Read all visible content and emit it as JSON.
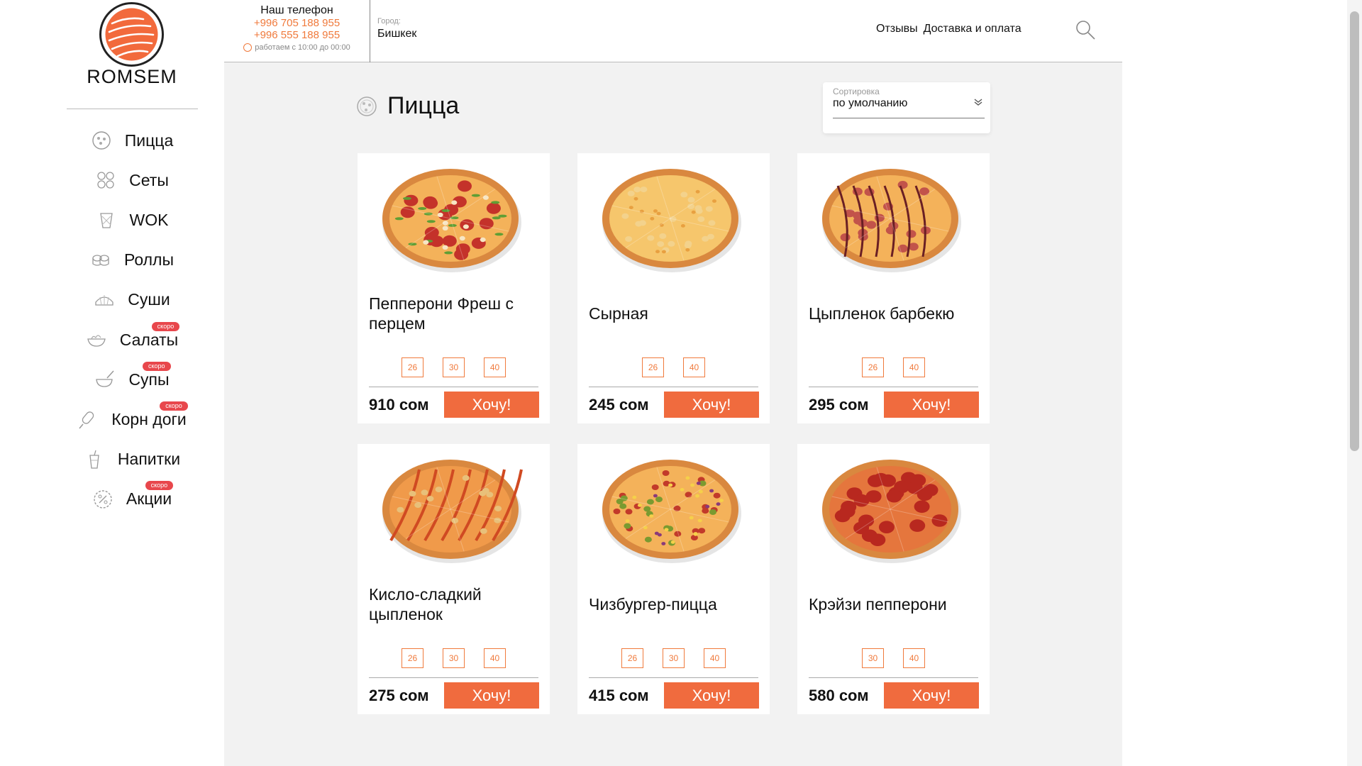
{
  "brand": {
    "name": "ROMSEM"
  },
  "sidebar": {
    "items": [
      {
        "label": "Пицца",
        "icon": "pizza-icon",
        "badge": ""
      },
      {
        "label": "Сеты",
        "icon": "sets-icon",
        "badge": ""
      },
      {
        "label": "WOK",
        "icon": "wok-icon",
        "badge": ""
      },
      {
        "label": "Роллы",
        "icon": "rolls-icon",
        "badge": ""
      },
      {
        "label": "Суши",
        "icon": "sushi-icon",
        "badge": ""
      },
      {
        "label": "Салаты",
        "icon": "salad-icon",
        "badge": "скоро"
      },
      {
        "label": "Супы",
        "icon": "soup-icon",
        "badge": "скоро"
      },
      {
        "label": "Корн доги",
        "icon": "corndog-icon",
        "badge": "скоро"
      },
      {
        "label": "Напитки",
        "icon": "drink-icon",
        "badge": ""
      },
      {
        "label": "Акции",
        "icon": "discount-icon",
        "badge": "скоро"
      }
    ]
  },
  "header": {
    "phone_title": "Наш телефон",
    "phones": [
      "+996 705 188 955",
      "+996 555 188 955"
    ],
    "hours": "работаем с 10:00 до 00:00",
    "city_label": "Город:",
    "city": "Бишкек",
    "links": [
      "Отзывы",
      "Доставка и оплата"
    ]
  },
  "page": {
    "title": "Пицца"
  },
  "sort": {
    "label": "Сортировка",
    "value": "по умолчанию"
  },
  "products": [
    {
      "name": "Пепперони Фреш с перцем",
      "sizes": [
        "26",
        "30",
        "40"
      ],
      "price": "910 сом",
      "button": "Хочу!",
      "topping": "pepperoni-pepper"
    },
    {
      "name": "Сырная",
      "sizes": [
        "26",
        "40"
      ],
      "price": "245 сом",
      "button": "Хочу!",
      "topping": "cheese"
    },
    {
      "name": "Цыпленок барбекю",
      "sizes": [
        "26",
        "40"
      ],
      "price": "295 сом",
      "button": "Хочу!",
      "topping": "bbq"
    },
    {
      "name": "Кисло-сладкий цыпленок",
      "sizes": [
        "26",
        "30",
        "40"
      ],
      "price": "275 сом",
      "button": "Хочу!",
      "topping": "sweet-sour"
    },
    {
      "name": "Чизбургер-пицца",
      "sizes": [
        "26",
        "30",
        "40"
      ],
      "price": "415 сом",
      "button": "Хочу!",
      "topping": "cheeseburger"
    },
    {
      "name": "Крэйзи пепперони",
      "sizes": [
        "30",
        "40"
      ],
      "price": "580 сом",
      "button": "Хочу!",
      "topping": "pepperoni"
    }
  ],
  "colors": {
    "accent": "#f06b3e",
    "badge": "#e8474c",
    "background": "#f2f2f2"
  }
}
